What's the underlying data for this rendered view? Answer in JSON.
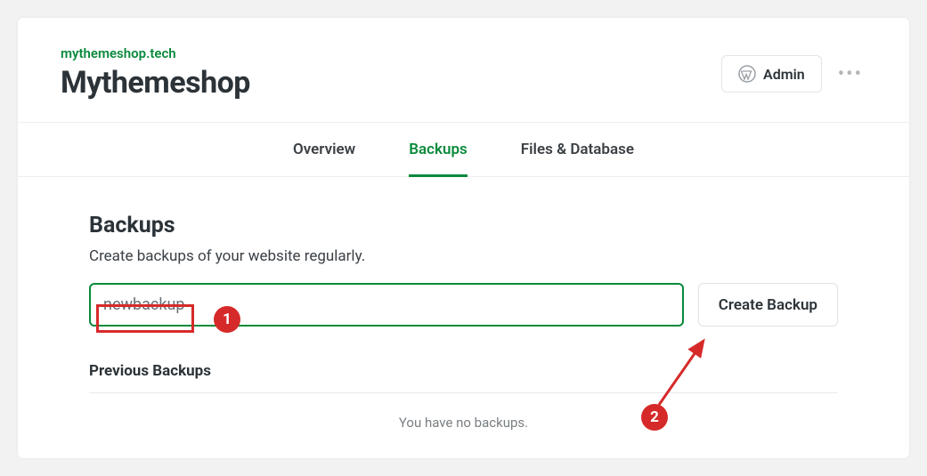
{
  "header": {
    "domain": "mythemeshop.tech",
    "title": "Mythemeshop",
    "admin_label": "Admin"
  },
  "tabs": {
    "overview": "Overview",
    "backups": "Backups",
    "files_db": "Files & Database"
  },
  "backups": {
    "title": "Backups",
    "description": "Create backups of your website regularly.",
    "input_value": "newbackup",
    "create_label": "Create Backup",
    "previous_title": "Previous Backups",
    "empty_text": "You have no backups."
  },
  "annotations": {
    "badge1": "1",
    "badge2": "2"
  }
}
